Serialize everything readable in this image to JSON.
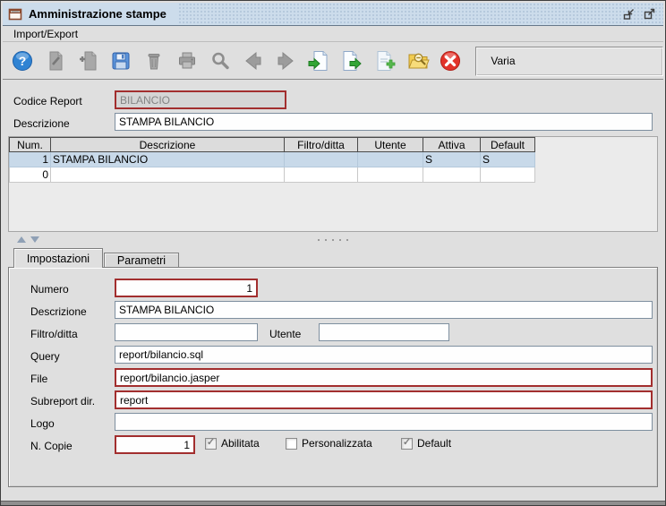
{
  "window": {
    "title": "Amministrazione stampe",
    "title_icons": [
      "window-icon",
      "restore-icon",
      "maximize-icon"
    ]
  },
  "menu": {
    "items": [
      "Import/Export"
    ]
  },
  "toolbar": {
    "status_text": "Varia",
    "buttons": [
      {
        "name": "help",
        "enabled": true
      },
      {
        "name": "edit-document",
        "enabled": false
      },
      {
        "name": "copy-document",
        "enabled": false
      },
      {
        "name": "save",
        "enabled": true
      },
      {
        "name": "delete",
        "enabled": false
      },
      {
        "name": "print",
        "enabled": false
      },
      {
        "name": "search",
        "enabled": false
      },
      {
        "name": "previous",
        "enabled": false
      },
      {
        "name": "next",
        "enabled": false
      },
      {
        "name": "import",
        "enabled": true
      },
      {
        "name": "export",
        "enabled": true
      },
      {
        "name": "add-report",
        "enabled": true
      },
      {
        "name": "find-file",
        "enabled": true
      },
      {
        "name": "exit",
        "enabled": true
      }
    ]
  },
  "header_form": {
    "codice_label": "Codice Report",
    "codice_value": "BILANCIO",
    "descrizione_label": "Descrizione",
    "descrizione_value": "STAMPA BILANCIO"
  },
  "table": {
    "columns": [
      "Num.",
      "Descrizione",
      "Filtro/ditta",
      "Utente",
      "Attiva",
      "Default"
    ],
    "rows": [
      {
        "cells": [
          "1",
          "STAMPA BILANCIO",
          "",
          "",
          "S",
          "S"
        ],
        "selected": true
      },
      {
        "cells": [
          "0",
          "",
          "",
          "",
          "",
          ""
        ],
        "selected": false
      }
    ]
  },
  "tabs": [
    {
      "label": "Impostazioni",
      "active": true
    },
    {
      "label": "Parametri",
      "active": false
    }
  ],
  "settings_form": {
    "numero": {
      "label": "Numero",
      "value": "1"
    },
    "descrizione": {
      "label": "Descrizione",
      "value": "STAMPA BILANCIO"
    },
    "filtro": {
      "label": "Filtro/ditta",
      "value": ""
    },
    "utente": {
      "label": "Utente",
      "value": ""
    },
    "query": {
      "label": "Query",
      "value": "report/bilancio.sql"
    },
    "file": {
      "label": "File",
      "value": "report/bilancio.jasper"
    },
    "subreport": {
      "label": "Subreport dir.",
      "value": "report"
    },
    "logo": {
      "label": "Logo",
      "value": ""
    },
    "copie": {
      "label": "N. Copie",
      "value": "1"
    },
    "checks": [
      {
        "label": "Abilitata",
        "checked": true
      },
      {
        "label": "Personalizzata",
        "checked": false
      },
      {
        "label": "Default",
        "checked": true
      }
    ]
  },
  "colors": {
    "titlebar": "#CCDCEB",
    "panel": "#DFDFDF",
    "selected_row": "#C8D9E9",
    "required_border": "#A22E2E",
    "table_header": "#DCDCDC"
  }
}
